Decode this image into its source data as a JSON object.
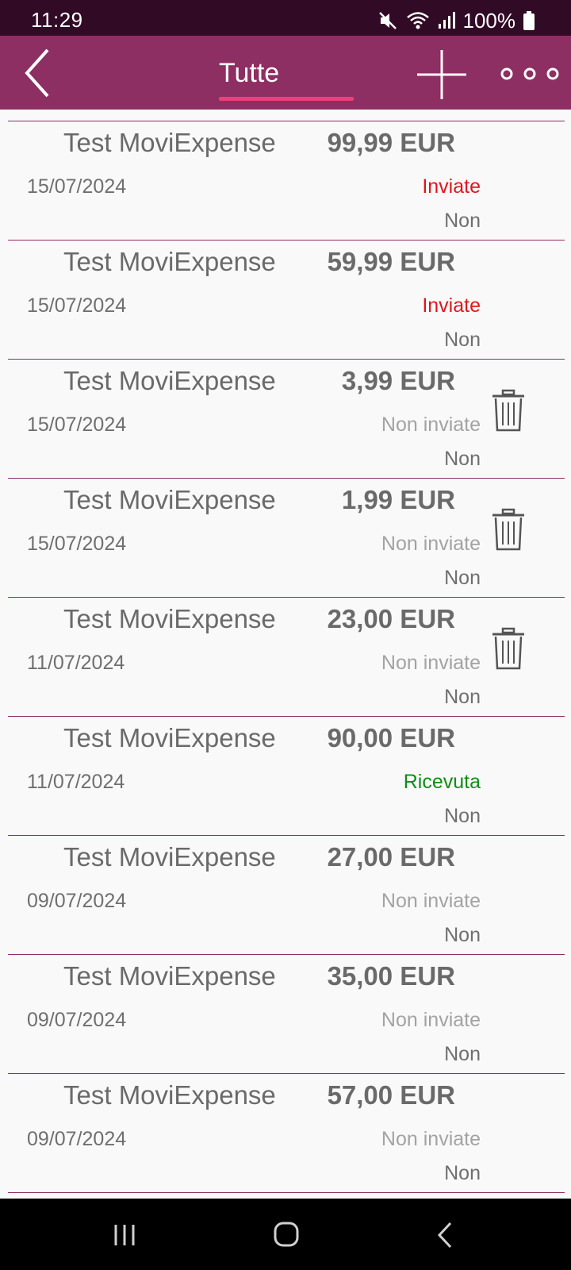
{
  "status_bar": {
    "time": "11:29",
    "battery": "100%",
    "icons": [
      "mute-icon",
      "wifi-icon",
      "signal-icon",
      "battery-icon"
    ]
  },
  "app_bar": {
    "tab": "Tutte",
    "icons": [
      "back-icon",
      "plus-icon",
      "more-icon"
    ]
  },
  "colors": {
    "status_bar": "#310b26",
    "app_bar": "#8d2f62",
    "tab_indicator": "#ec407a",
    "sent": "#e0161b",
    "received": "#108d17",
    "not_sent": "#a3a3a3",
    "separator": "#8d2f62"
  },
  "expenses": [
    {
      "title": "Test MoviExpense",
      "amount": "99,99 EUR",
      "date": "15/07/2024",
      "status": "Inviate",
      "status_color": "#e0161b",
      "flag": "Non",
      "deletable": false
    },
    {
      "title": "Test MoviExpense",
      "amount": "59,99 EUR",
      "date": "15/07/2024",
      "status": "Inviate",
      "status_color": "#e0161b",
      "flag": "Non",
      "deletable": false
    },
    {
      "title": "Test MoviExpense",
      "amount": "3,99 EUR",
      "date": "15/07/2024",
      "status": "Non inviate",
      "status_color": "#a3a3a3",
      "flag": "Non",
      "deletable": true
    },
    {
      "title": "Test MoviExpense",
      "amount": "1,99 EUR",
      "date": "15/07/2024",
      "status": "Non inviate",
      "status_color": "#a3a3a3",
      "flag": "Non",
      "deletable": true
    },
    {
      "title": "Test MoviExpense",
      "amount": "23,00 EUR",
      "date": "11/07/2024",
      "status": "Non inviate",
      "status_color": "#a3a3a3",
      "flag": "Non",
      "deletable": true
    },
    {
      "title": "Test MoviExpense",
      "amount": "90,00 EUR",
      "date": "11/07/2024",
      "status": "Ricevuta",
      "status_color": "#108d17",
      "flag": "Non",
      "deletable": false
    },
    {
      "title": "Test MoviExpense",
      "amount": "27,00 EUR",
      "date": "09/07/2024",
      "status": "Non inviate",
      "status_color": "#a3a3a3",
      "flag": "Non",
      "deletable": false
    },
    {
      "title": "Test MoviExpense",
      "amount": "35,00 EUR",
      "date": "09/07/2024",
      "status": "Non inviate",
      "status_color": "#a3a3a3",
      "flag": "Non",
      "deletable": false
    },
    {
      "title": "Test MoviExpense",
      "amount": "57,00 EUR",
      "date": "09/07/2024",
      "status": "Non inviate",
      "status_color": "#a3a3a3",
      "flag": "Non",
      "deletable": false
    }
  ],
  "nav_bar": {
    "icons": [
      "recent-apps-icon",
      "home-icon",
      "back-nav-icon"
    ]
  }
}
